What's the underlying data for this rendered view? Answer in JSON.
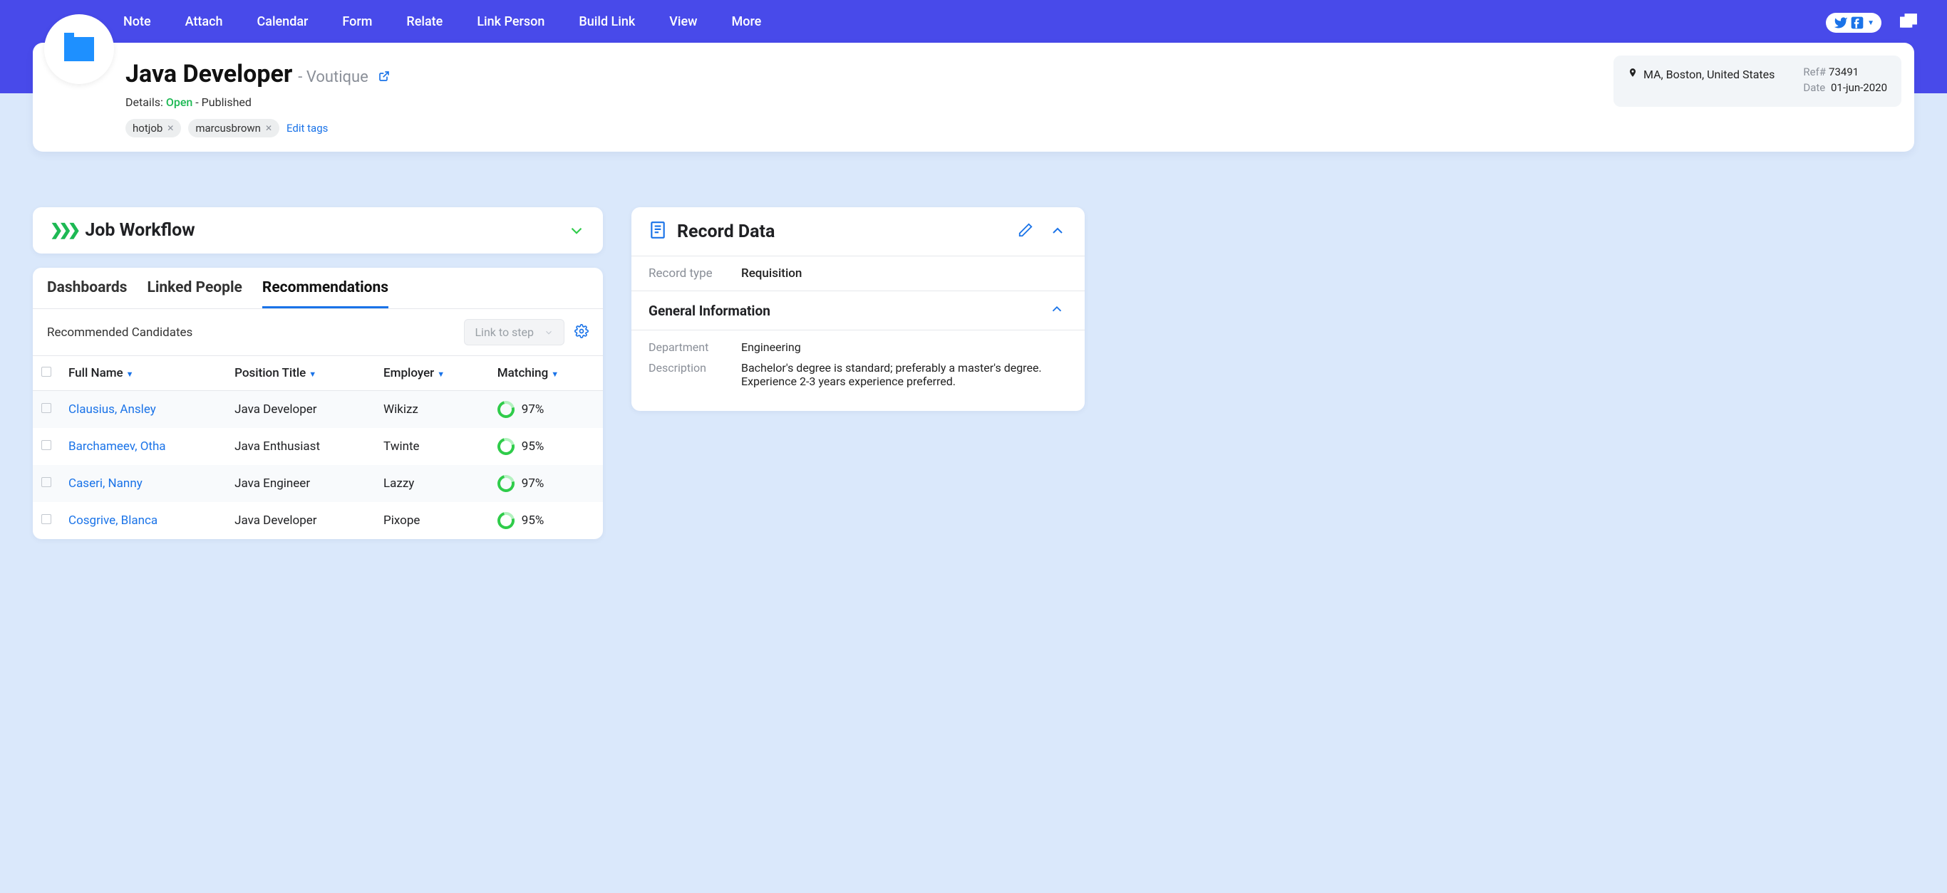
{
  "nav": [
    "Note",
    "Attach",
    "Calendar",
    "Form",
    "Relate",
    "Link Person",
    "Build Link",
    "View",
    "More"
  ],
  "job": {
    "title": "Java Developer",
    "company": "- Voutique",
    "details_label": "Details:",
    "status": "Open",
    "published": "- Published",
    "tags": [
      "hotjob",
      "marcusbrown"
    ],
    "edit_tags": "Edit tags",
    "location": "MA, Boston, United States",
    "ref_label": "Ref#",
    "ref": "73491",
    "date_label": "Date",
    "date": "01-jun-2020"
  },
  "workflow": {
    "title": "Job Workflow"
  },
  "tabs": [
    "Dashboards",
    "Linked People",
    "Recommendations"
  ],
  "active_tab": 2,
  "rec": {
    "label": "Recommended Candidates",
    "link_step": "Link to step",
    "cols": [
      "Full Name",
      "Position Title",
      "Employer",
      "Matching"
    ],
    "rows": [
      {
        "name": "Clausius, Ansley",
        "pos": "Java Developer",
        "emp": "Wikizz",
        "match": "97%"
      },
      {
        "name": "Barchameev, Otha",
        "pos": "Java Enthusiast",
        "emp": "Twinte",
        "match": "95%"
      },
      {
        "name": "Caseri, Nanny",
        "pos": "Java Engineer",
        "emp": "Lazzy",
        "match": "97%"
      },
      {
        "name": "Cosgrive, Blanca",
        "pos": "Java Developer",
        "emp": "Pixope",
        "match": "95%"
      }
    ]
  },
  "record": {
    "title": "Record Data",
    "type_label": "Record type",
    "type_value": "Requisition",
    "gi_title": "General Information",
    "dept_label": "Department",
    "dept_value": "Engineering",
    "desc_label": "Description",
    "desc_value": "Bachelor's degree is standard; preferably a master's degree. Experience 2-3 years experience preferred."
  }
}
